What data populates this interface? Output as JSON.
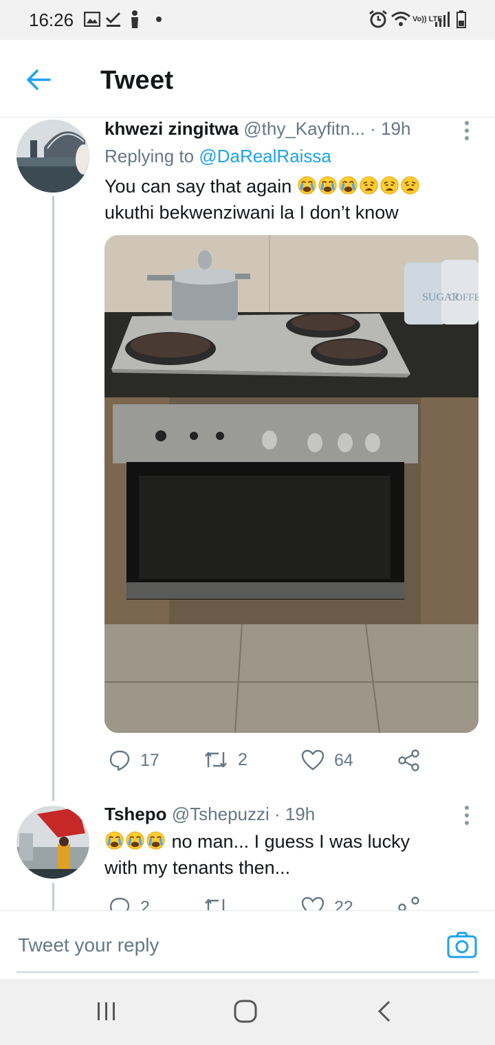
{
  "status_bar": {
    "time": "16:26",
    "network_label": "Vo)) LTE"
  },
  "header": {
    "title": "Tweet"
  },
  "tweet1": {
    "display_name": "khwezi zingitwa",
    "handle_time": "@thy_Kayfitn... · 19h",
    "replying_prefix": "Replying to ",
    "replying_to": "@DaRealRaissa",
    "text_line1": "You can say that again",
    "text_line2": "ukuthi bekwenziwani la I don’t know",
    "emojis": [
      "crying-face",
      "crying-face",
      "crying-face",
      "weary-face",
      "weary-face",
      "weary-face"
    ],
    "media_text": [
      "SUGAR",
      "COFFEE"
    ],
    "replies": "17",
    "retweets": "2",
    "likes": "64"
  },
  "tweet2": {
    "display_name": "Tshepo",
    "handle_time": "@Tshepuzzi · 19h",
    "text_line1": "no man... I guess I was lucky",
    "text_line2": "with my tenants then...",
    "emojis": [
      "crying-face",
      "crying-face",
      "crying-face"
    ],
    "replies": "2",
    "likes": "22"
  },
  "reply_box": {
    "placeholder": "Tweet your reply"
  },
  "colors": {
    "accent": "#1da1f2",
    "muted": "#657786",
    "thread_line": "#c4cfd6"
  }
}
